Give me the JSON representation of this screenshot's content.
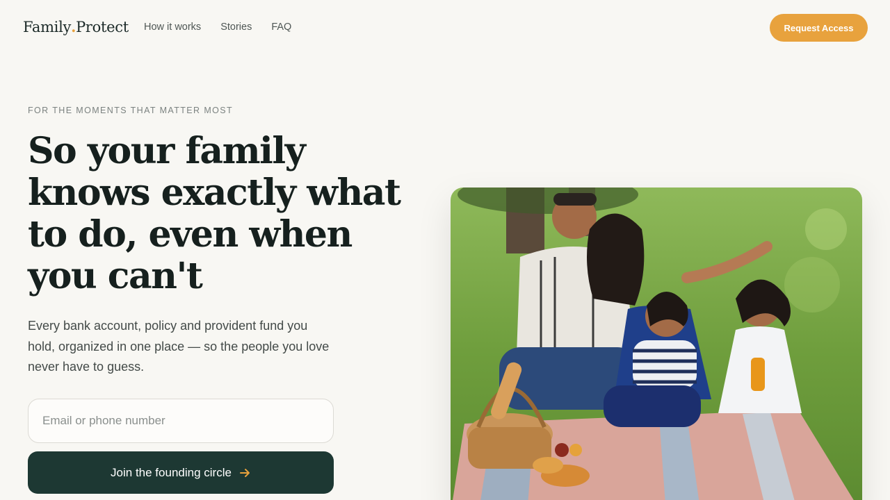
{
  "nav": {
    "logo": {
      "part1": "Family",
      "dot": ".",
      "part2": "Protect"
    },
    "links": [
      "How it works",
      "Stories",
      "FAQ"
    ],
    "cta_label": "Request Access"
  },
  "hero": {
    "eyebrow": "FOR THE MOMENTS THAT MATTER MOST",
    "headline": "So your family knows exactly what to do, even when you can't",
    "subtext": "Every bank account, policy and provident fund you hold, organized in one place — so the people you love never have to guess.",
    "email_placeholder": "Email or phone number",
    "email_value": "",
    "join_label": "Join the founding circle",
    "join_icon": "arrow-right-icon"
  },
  "photo": {
    "subject": "family-picnic-photo"
  },
  "colors": {
    "background": "#f8f7f3",
    "accent": "#e8a23d",
    "primary_dark": "#1d3833",
    "text_dark": "#16201e"
  }
}
